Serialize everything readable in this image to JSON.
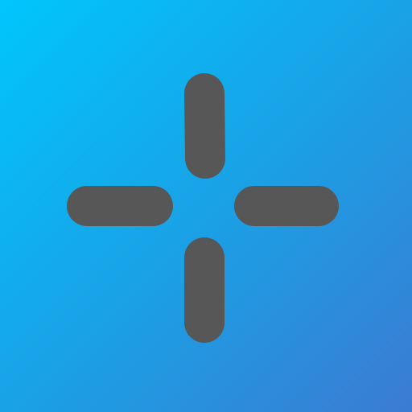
{
  "app": {
    "background": {
      "gradient_start": "#00c6fd",
      "gradient_mid": "#19a2e6",
      "gradient_end": "#3b7bd3"
    },
    "icon": {
      "name": "crosshair-icon",
      "color": "#575757"
    }
  }
}
